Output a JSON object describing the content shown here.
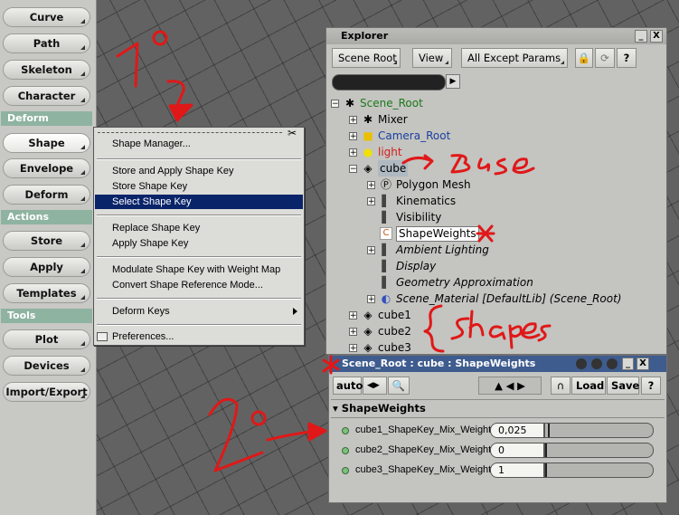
{
  "toolbar": {
    "buttons": {
      "curve": "Curve",
      "path": "Path",
      "skeleton": "Skeleton",
      "character": "Character",
      "shape": "Shape",
      "envelope": "Envelope",
      "deform": "Deform",
      "store": "Store",
      "apply": "Apply",
      "templates": "Templates",
      "plot": "Plot",
      "devices": "Devices",
      "import_export": "Import/Export"
    },
    "headers": {
      "deform": "Deform",
      "actions": "Actions",
      "tools": "Tools"
    }
  },
  "context_menu": {
    "items": [
      "Shape Manager...",
      "Store and Apply Shape Key",
      "Store Shape Key",
      "Select Shape Key",
      "Replace Shape Key",
      "Apply Shape Key",
      "Modulate Shape Key with Weight Map",
      "Convert Shape Reference Mode...",
      "Deform Keys",
      "Preferences..."
    ],
    "selected": "Select Shape Key"
  },
  "explorer": {
    "title": "Explorer",
    "buttons": {
      "scope": "Scene Root",
      "view": "View",
      "filter": "All Except Params"
    },
    "tree": [
      {
        "label": "Scene_Root",
        "color": "#1a7a1a"
      },
      {
        "label": "Mixer",
        "color": "#000000"
      },
      {
        "label": "Camera_Root",
        "color": "#1a3fa0"
      },
      {
        "label": "light",
        "color": "#d02020"
      },
      {
        "label": "cube",
        "color": "#000000"
      },
      {
        "label": "Polygon Mesh",
        "color": "#000000"
      },
      {
        "label": "Kinematics",
        "color": "#000000"
      },
      {
        "label": "Visibility",
        "color": "#000000"
      },
      {
        "label": "ShapeWeights",
        "color": "#000000"
      },
      {
        "label": "Ambient Lighting",
        "color": "#000000"
      },
      {
        "label": "Display",
        "color": "#000000"
      },
      {
        "label": "Geometry Approximation",
        "color": "#000000"
      },
      {
        "label": "Scene_Material [DefaultLib] (Scene_Root)",
        "color": "#000000"
      },
      {
        "label": "cube1",
        "color": "#000000"
      },
      {
        "label": "cube2",
        "color": "#000000"
      },
      {
        "label": "cube3",
        "color": "#000000"
      }
    ]
  },
  "property_panel": {
    "title": "Scene_Root : cube : ShapeWeights",
    "auto": "auto",
    "load": "Load",
    "save": "Save",
    "section": "ShapeWeights",
    "sliders": [
      {
        "label": "cube1_ShapeKey_Mix_Weight",
        "value": "0,025",
        "level": 0.025
      },
      {
        "label": "cube2_ShapeKey_Mix_Weight",
        "value": "0",
        "level": 0
      },
      {
        "label": "cube3_ShapeKey_Mix_Weight",
        "value": "1",
        "level": 1
      }
    ]
  },
  "annotations": {
    "step1": "1º",
    "step2": "2º",
    "base": "Base",
    "shapes": "Shapes"
  },
  "colors": {
    "selection": "#0a246a",
    "toolbar_header": "#8fb3a1",
    "annotation": "#e01818"
  }
}
